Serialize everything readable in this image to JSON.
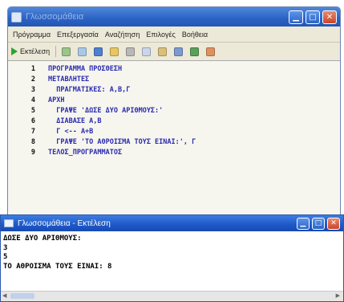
{
  "editor": {
    "title": "Γλωσσομάθεια",
    "menu": [
      "Πρόγραμμα",
      "Επεξεργασία",
      "Αναζήτηση",
      "Επιλογές",
      "Βοήθεια"
    ],
    "run_label": "Εκτέλεση",
    "toolbar_icons": [
      {
        "name": "undo-icon",
        "color": "#9bc58a"
      },
      {
        "name": "redo-icon",
        "color": "#a8c8e8"
      },
      {
        "name": "save-icon",
        "color": "#4f7fd0"
      },
      {
        "name": "open-icon",
        "color": "#e8c660"
      },
      {
        "name": "cut-icon",
        "color": "#b8b8b8"
      },
      {
        "name": "copy-icon",
        "color": "#c9d6ea"
      },
      {
        "name": "paste-icon",
        "color": "#d9c07a"
      },
      {
        "name": "find-icon",
        "color": "#7a9ad0"
      },
      {
        "name": "replace-icon",
        "color": "#5aa05a"
      },
      {
        "name": "help-icon",
        "color": "#e09060"
      }
    ],
    "code_lines": [
      {
        "n": "1",
        "text": "ΠΡΟΓΡΑΜΜΑ ΠΡΟΣΘΕΣΗ"
      },
      {
        "n": "2",
        "text": "ΜΕΤΑΒΛΗΤΕΣ"
      },
      {
        "n": "3",
        "text": "  ΠΡΑΓΜΑΤΙΚΕΣ: Α,Β,Γ"
      },
      {
        "n": "4",
        "text": "ΑΡΧΗ"
      },
      {
        "n": "5",
        "text": "  ΓΡΑΨΕ 'ΔΩΣΕ ΔΥΟ ΑΡΙΘΜΟΥΣ:'"
      },
      {
        "n": "6",
        "text": "  ΔΙΑΒΑΣΕ Α,Β"
      },
      {
        "n": "7",
        "text": "  Γ <-- Α+Β"
      },
      {
        "n": "8",
        "text": "  ΓΡΑΨΕ 'ΤΟ ΑΘΡΟΙΣΜΑ ΤΟΥΣ ΕΙΝΑΙ:', Γ"
      },
      {
        "n": "9",
        "text": "ΤΕΛΟΣ_ΠΡΟΓΡΑΜΜΑΤΟΣ"
      }
    ]
  },
  "console": {
    "title": "Γλωσσομάθεια - Εκτέλεση",
    "output": [
      "ΔΩΣΕ ΔΥΟ ΑΡΙΘΜΟΥΣ:",
      "3",
      "5",
      "ΤΟ ΑΘΡΟΙΣΜΑ ΤΟΥΣ ΕΙΝΑΙ: 8"
    ]
  },
  "colors": {
    "title_blue": "#2a62c4",
    "keyword_blue": "#2b2bb0",
    "close_red": "#c9452a",
    "run_green": "#2da32d"
  }
}
